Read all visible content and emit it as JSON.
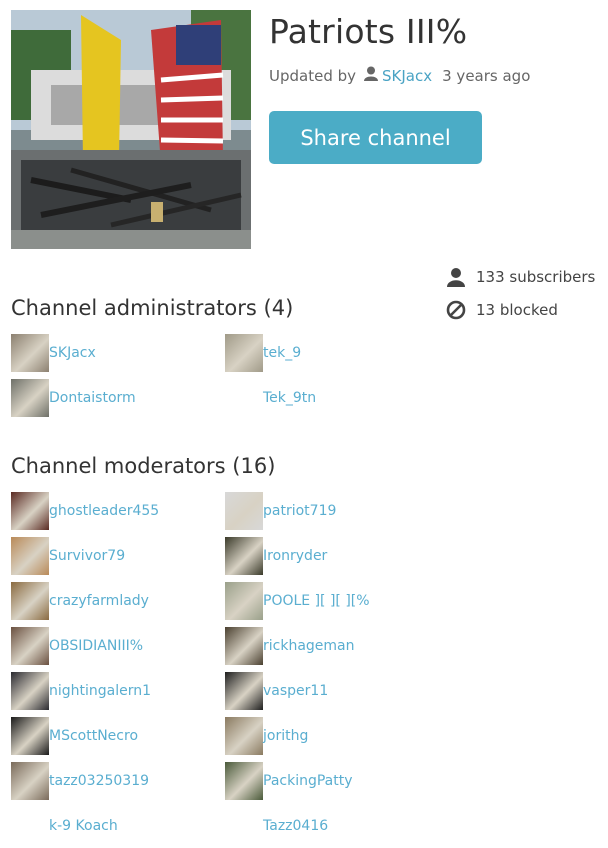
{
  "channel": {
    "title": "Patriots III%",
    "updated_prefix": "Updated by",
    "updated_user": "SKJacx",
    "updated_ago": "3 years ago",
    "share_label": "Share channel"
  },
  "stats": {
    "subscribers": "133 subscribers",
    "blocked": "13 blocked"
  },
  "administrators": {
    "heading": "Channel administrators (4)",
    "members": [
      {
        "name": "SKJacx",
        "avatar": "#8c8070"
      },
      {
        "name": "tek_9",
        "avatar": "#a09a88"
      },
      {
        "name": "Dontaistorm",
        "avatar": "#6e7068"
      },
      {
        "name": "Tek_9tn",
        "avatar": ""
      }
    ]
  },
  "moderators": {
    "heading": "Channel moderators (16)",
    "members": [
      {
        "name": "ghostleader455",
        "avatar": "#5a2a22"
      },
      {
        "name": "patriot719",
        "avatar": "#d8d8d8"
      },
      {
        "name": "Survivor79",
        "avatar": "#b98a58"
      },
      {
        "name": "Ironryder",
        "avatar": "#3a3a2a"
      },
      {
        "name": "crazyfarmlady",
        "avatar": "#8a6a40"
      },
      {
        "name": "POOLE ][ ][ ][%",
        "avatar": "#9aa08a"
      },
      {
        "name": "OBSIDIANIII%",
        "avatar": "#6a5040"
      },
      {
        "name": "rickhageman",
        "avatar": "#4a4030"
      },
      {
        "name": "nightingalern1",
        "avatar": "#2a2a30"
      },
      {
        "name": "vasper11",
        "avatar": "#1e1e1e"
      },
      {
        "name": "MScottNecro",
        "avatar": "#1a1a1a"
      },
      {
        "name": "jorithg",
        "avatar": "#8a7a60"
      },
      {
        "name": "tazz03250319",
        "avatar": "#7a6a5a"
      },
      {
        "name": "PackingPatty",
        "avatar": "#4a5a3a"
      },
      {
        "name": "k-9 Koach",
        "avatar": ""
      },
      {
        "name": "Tazz0416",
        "avatar": ""
      }
    ]
  },
  "icons": {
    "updated_user": "user-icon",
    "subscribers": "user-icon",
    "blocked": "blocked-icon"
  },
  "colors": {
    "accent": "#4bacc6",
    "link": "#5aaed0"
  }
}
